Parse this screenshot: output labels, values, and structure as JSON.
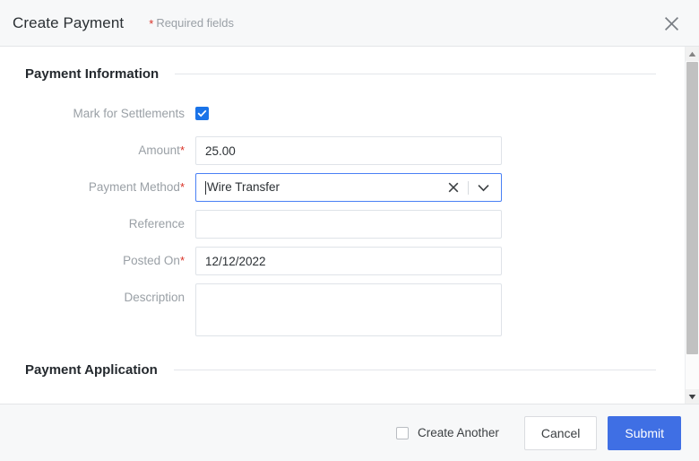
{
  "header": {
    "title": "Create Payment",
    "required_note": "Required fields",
    "required_star": "*",
    "close_icon": "close-icon"
  },
  "sections": {
    "payment_information": {
      "title": "Payment Information"
    },
    "payment_application": {
      "title": "Payment Application"
    }
  },
  "fields": {
    "mark_for_settlements": {
      "label": "Mark for Settlements",
      "checked": true
    },
    "amount": {
      "label": "Amount",
      "required_star": "*",
      "value": "25.00",
      "placeholder": ""
    },
    "payment_method": {
      "label": "Payment Method",
      "required_star": "*",
      "value": "Wire Transfer",
      "clear_icon": "close-icon",
      "dropdown_icon": "chevron-down-icon",
      "focused": true
    },
    "reference": {
      "label": "Reference",
      "value": "",
      "placeholder": ""
    },
    "posted_on": {
      "label": "Posted On",
      "required_star": "*",
      "value": "12/12/2022",
      "placeholder": ""
    },
    "description": {
      "label": "Description",
      "value": "",
      "placeholder": ""
    }
  },
  "scrollbar": {
    "up_icon": "triangle-up-icon",
    "down_icon": "triangle-down-icon"
  },
  "footer": {
    "create_another": {
      "label": "Create Another",
      "checked": false
    },
    "cancel_label": "Cancel",
    "submit_label": "Submit"
  },
  "colors": {
    "accent": "#3f6fe4",
    "checkbox_checked": "#1a73e8",
    "required_star": "#d93025",
    "focus_border": "#4a80f5",
    "header_bg": "#f7f8f9"
  }
}
